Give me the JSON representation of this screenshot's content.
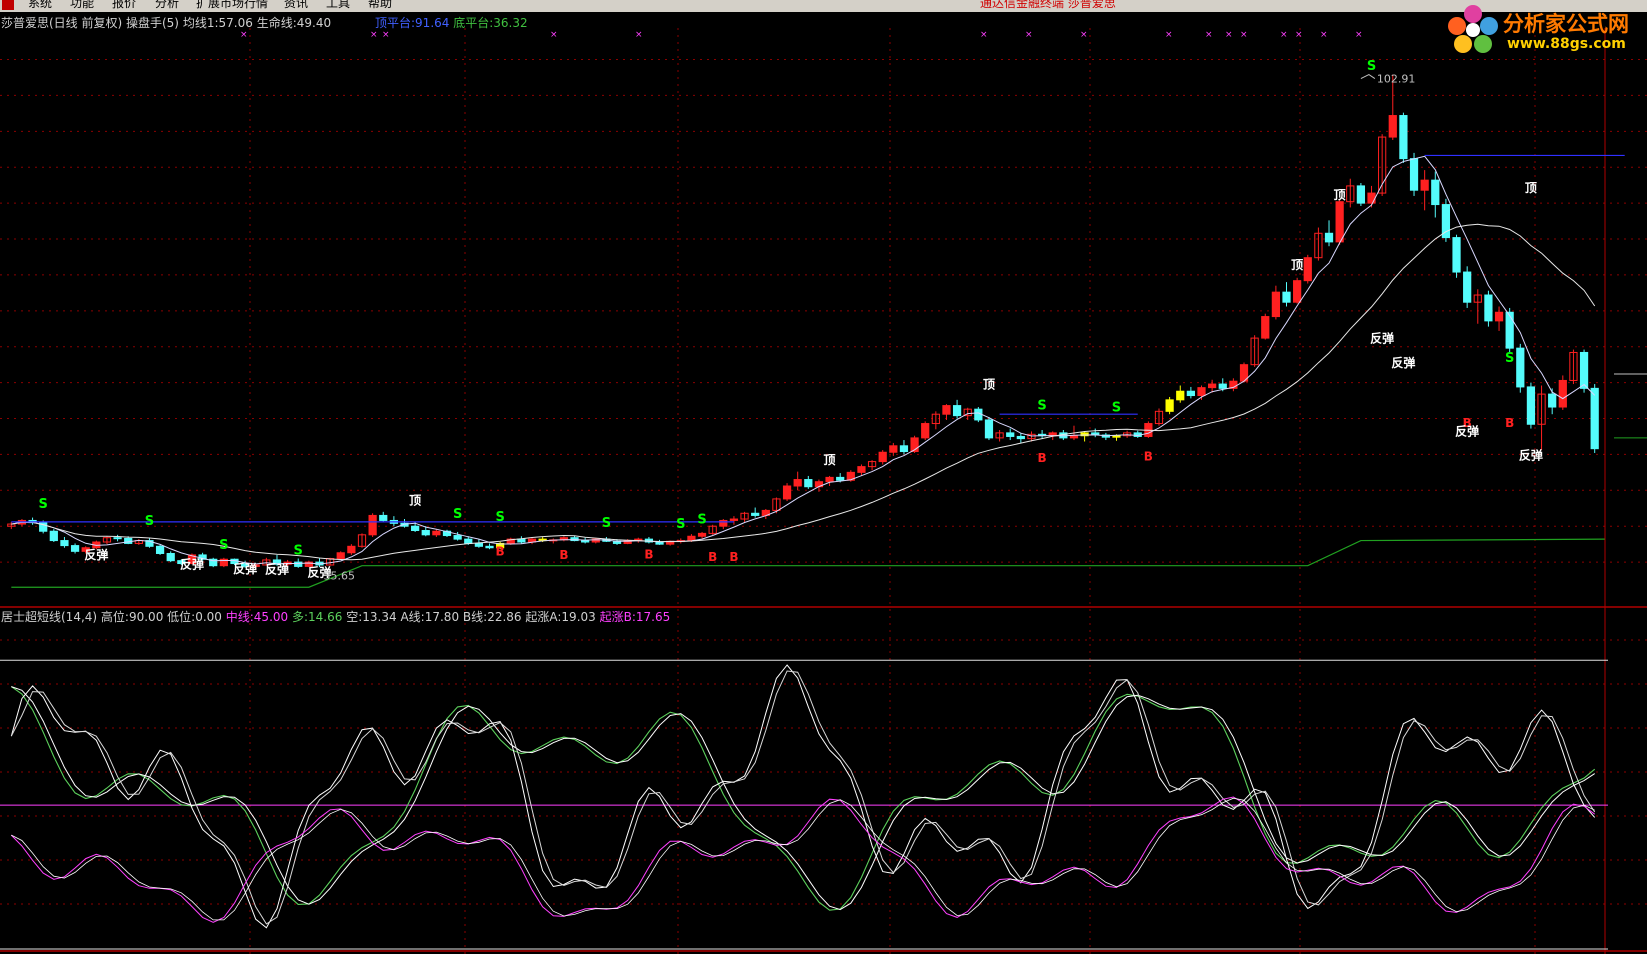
{
  "menu": {
    "items": [
      "系统",
      "功能",
      "报价",
      "分析",
      "扩展市场行情",
      "资讯",
      "工具",
      "帮助"
    ],
    "promo": "通达信金融终端  莎普爱思"
  },
  "brand": {
    "name": "分析家公式网",
    "url": "www.88gs.com"
  },
  "main_header": {
    "title": "莎普爱思(日线 前复权) 操盘手(5)",
    "ma1_label": "均线1:",
    "ma1_value": "57.06",
    "life_label": "生命线:",
    "life_value": "49.40",
    "top_platform_label": "顶平台:",
    "top_platform_value": "91.64",
    "bottom_platform_label": "底平台:",
    "bottom_platform_value": "36.32"
  },
  "indicator_header": {
    "title": "居士超短线(14,4)",
    "high_label": "高位:",
    "high_value": "90.00",
    "low_label": "低位:",
    "low_value": "0.00",
    "mid_label": "中线:",
    "mid_value": "45.00",
    "long_label": "多:",
    "long_value": "14.66",
    "short_label": "空:",
    "short_value": "13.34",
    "a_label": "A线:",
    "a_value": "17.80",
    "b_label": "B线:",
    "b_value": "22.86",
    "risea_label": "起涨A:",
    "risea_value": "19.03",
    "riseb_label": "起涨B:",
    "riseb_value": "17.65"
  },
  "annotations": {
    "peak_price": "102.91",
    "low_price": "35.65",
    "top_label": "顶",
    "rebound_label": "反弹",
    "buy_label": "B",
    "sell_label": "S"
  },
  "colors": {
    "up": "#ff2020",
    "down": "#54fcfc",
    "flat": "#ffff00",
    "ma": "#d8d8ff",
    "life": "#e8e8e8",
    "platform_top": "#3030ff",
    "platform_bottom": "#20a020",
    "buy": "#ff2020",
    "sell": "#00ff00",
    "grid": "#8b0000",
    "magenta": "#ff40ff",
    "green": "#5cd05c"
  },
  "chart_data": {
    "type": "candlestick",
    "price_range": [
      30,
      108
    ],
    "ohlc": [
      [
        40,
        40.6,
        39.6,
        40.3
      ],
      [
        40.3,
        41,
        40,
        40.8
      ],
      [
        40.8,
        41.2,
        40.2,
        40.5
      ],
      [
        40.5,
        40.8,
        39,
        39.3
      ],
      [
        39.3,
        39.6,
        37.8,
        38
      ],
      [
        38,
        38.5,
        37,
        37.3
      ],
      [
        37.3,
        37.6,
        36.2,
        36.5
      ],
      [
        36.5,
        37.2,
        36.2,
        37
      ],
      [
        37,
        38,
        36.8,
        37.8
      ],
      [
        37.8,
        38.6,
        37.5,
        38.4
      ],
      [
        38.4,
        38.8,
        37.9,
        38.3
      ],
      [
        38.3,
        38.6,
        37.5,
        37.6
      ],
      [
        37.6,
        38.2,
        37.4,
        38
      ],
      [
        38,
        38.3,
        37,
        37.2
      ],
      [
        37.2,
        37.4,
        36,
        36.2
      ],
      [
        36.2,
        36.5,
        35,
        35.2
      ],
      [
        35.2,
        35.4,
        34.6,
        34.8
      ],
      [
        34.8,
        36.2,
        34.7,
        36
      ],
      [
        36,
        36.3,
        35.2,
        35.4
      ],
      [
        35.4,
        35.6,
        34.3,
        34.5
      ],
      [
        34.5,
        35.6,
        34.3,
        35.4
      ],
      [
        35.4,
        35.5,
        34.6,
        34.8
      ],
      [
        34.8,
        35.2,
        34.2,
        34.4
      ],
      [
        34.4,
        34.8,
        34,
        34.6
      ],
      [
        34.6,
        35.6,
        34.5,
        35.3
      ],
      [
        35.3,
        36,
        34.5,
        34.7
      ],
      [
        34.7,
        35.3,
        34.3,
        35
      ],
      [
        35,
        35.5,
        34.2,
        34.4
      ],
      [
        34.4,
        35.2,
        34.3,
        35
      ],
      [
        35,
        35.5,
        34.3,
        34.6
      ],
      [
        34.6,
        35.6,
        34.5,
        35.5
      ],
      [
        35.5,
        36.5,
        35.3,
        36.3
      ],
      [
        36.3,
        37.5,
        36,
        37.2
      ],
      [
        37.2,
        39,
        37,
        38.8
      ],
      [
        38.8,
        41.8,
        38.5,
        41.5
      ],
      [
        41.5,
        42,
        40.6,
        40.8
      ],
      [
        40.8,
        41.4,
        40,
        40.4
      ],
      [
        40.4,
        41,
        39.8,
        40
      ],
      [
        40,
        40.6,
        39.2,
        39.4
      ],
      [
        39.4,
        40,
        38.6,
        38.8
      ],
      [
        38.8,
        39.6,
        38.5,
        39.3
      ],
      [
        39.3,
        39.5,
        38.5,
        38.7
      ],
      [
        38.7,
        39.2,
        38,
        38.2
      ],
      [
        38.2,
        38.6,
        37.4,
        37.6
      ],
      [
        37.6,
        38.2,
        37,
        37.2
      ],
      [
        37.2,
        37.6,
        36.8,
        37
      ],
      [
        37,
        37.8,
        36.8,
        37.6
      ],
      [
        37.6,
        38.4,
        37.4,
        38.2
      ],
      [
        38.2,
        38.6,
        37.6,
        37.8
      ],
      [
        37.8,
        38.4,
        37.5,
        38.2
      ],
      [
        38.2,
        38.5,
        37.8,
        38
      ],
      [
        38,
        38.3,
        37.6,
        38.1
      ],
      [
        38.1,
        38.6,
        37.9,
        38.4
      ],
      [
        38.4,
        38.7,
        37.9,
        38
      ],
      [
        38,
        38.4,
        37.6,
        37.8
      ],
      [
        37.8,
        38.3,
        37.6,
        38.2
      ],
      [
        38.2,
        38.5,
        37.8,
        37.9
      ],
      [
        37.9,
        38.2,
        37.4,
        37.6
      ],
      [
        37.6,
        38.2,
        37.5,
        38
      ],
      [
        38,
        38.4,
        37.7,
        38.2
      ],
      [
        38.2,
        38.5,
        37.6,
        37.8
      ],
      [
        37.8,
        38.1,
        37.4,
        37.5
      ],
      [
        37.5,
        38,
        37.3,
        37.9
      ],
      [
        37.9,
        38.3,
        37.6,
        38
      ],
      [
        38,
        38.9,
        37.8,
        38.6
      ],
      [
        38.6,
        39.2,
        38.3,
        39
      ],
      [
        39,
        40.2,
        38.8,
        40
      ],
      [
        40,
        41,
        39.6,
        40.8
      ],
      [
        40.8,
        41.4,
        40.2,
        41
      ],
      [
        41,
        42,
        40.6,
        41.8
      ],
      [
        41.8,
        42.6,
        41.2,
        41.5
      ],
      [
        41.5,
        42.4,
        41,
        42.2
      ],
      [
        42.2,
        44,
        41.8,
        43.8
      ],
      [
        43.8,
        46,
        43.5,
        45.6
      ],
      [
        45.6,
        47.6,
        45,
        46.5
      ],
      [
        46.5,
        47,
        45.2,
        45.5
      ],
      [
        45.5,
        46.5,
        44.8,
        46.2
      ],
      [
        46.2,
        47,
        45.6,
        46.8
      ],
      [
        46.8,
        47.4,
        46.1,
        46.4
      ],
      [
        46.4,
        47.8,
        46.2,
        47.5
      ],
      [
        47.5,
        48.6,
        47,
        48.3
      ],
      [
        48.3,
        49.2,
        47.8,
        49
      ],
      [
        49,
        50.6,
        48.6,
        50.3
      ],
      [
        50.3,
        51.6,
        49.8,
        51.2
      ],
      [
        51.2,
        52,
        50,
        50.4
      ],
      [
        50.4,
        52.6,
        50.2,
        52.3
      ],
      [
        52.3,
        54.6,
        52,
        54.3
      ],
      [
        54.3,
        56,
        53.5,
        55.6
      ],
      [
        55.6,
        57,
        54.8,
        56.8
      ],
      [
        56.8,
        57.6,
        55,
        55.4
      ],
      [
        55.4,
        56.5,
        54.8,
        56.3
      ],
      [
        56.3,
        56.6,
        54.5,
        54.8
      ],
      [
        54.8,
        55.2,
        52,
        52.3
      ],
      [
        52.3,
        53.4,
        51.8,
        53
      ],
      [
        53,
        53.6,
        52,
        52.5
      ],
      [
        52.5,
        53,
        51.6,
        52.2
      ],
      [
        52.2,
        53.2,
        51.8,
        52.8
      ],
      [
        52.8,
        53.4,
        52.2,
        52.6
      ],
      [
        52.6,
        53.2,
        52,
        53
      ],
      [
        53,
        53.4,
        52,
        52.3
      ],
      [
        52.3,
        54,
        52,
        52.6
      ],
      [
        52.6,
        53.2,
        51.8,
        53
      ],
      [
        53,
        53.6,
        52.4,
        52.7
      ],
      [
        52.7,
        53,
        52,
        52.4
      ],
      [
        52.4,
        52.8,
        51.9,
        52.6
      ],
      [
        52.6,
        53.3,
        52.3,
        53
      ],
      [
        53,
        53.3,
        52.3,
        52.5
      ],
      [
        52.5,
        54.6,
        52.3,
        54.3
      ],
      [
        54.3,
        56.4,
        54,
        56
      ],
      [
        56,
        58,
        55.6,
        57.6
      ],
      [
        57.6,
        59.6,
        57.2,
        58.8
      ],
      [
        58.8,
        59.4,
        57.8,
        58.2
      ],
      [
        58.2,
        59.6,
        57.6,
        59.3
      ],
      [
        59.3,
        60.4,
        58.6,
        59.8
      ],
      [
        59.8,
        60.6,
        58.8,
        59.2
      ],
      [
        59.2,
        60.6,
        58.8,
        60.2
      ],
      [
        60.2,
        62.8,
        60,
        62.5
      ],
      [
        62.5,
        66.6,
        62.2,
        66.2
      ],
      [
        66.2,
        69.6,
        66,
        69.2
      ],
      [
        69.2,
        73.5,
        68.8,
        72.6
      ],
      [
        72.6,
        74,
        70.6,
        71.2
      ],
      [
        71.2,
        74.6,
        71,
        74.2
      ],
      [
        74.2,
        77.8,
        73.8,
        77.4
      ],
      [
        77.4,
        81.6,
        77,
        80.8
      ],
      [
        80.8,
        82.6,
        79,
        79.6
      ],
      [
        79.6,
        85.6,
        79.2,
        85.2
      ],
      [
        85.2,
        88.4,
        84.4,
        87.4
      ],
      [
        87.4,
        87.8,
        84.6,
        85
      ],
      [
        85,
        87.4,
        84.4,
        86.4
      ],
      [
        86.4,
        94.6,
        86,
        94.2
      ],
      [
        94.2,
        102.91,
        93.8,
        97.2
      ],
      [
        97.2,
        97.6,
        90.6,
        91.2
      ],
      [
        91.2,
        92,
        86,
        86.8
      ],
      [
        86.8,
        89.6,
        84,
        88.2
      ],
      [
        88.2,
        89.4,
        83,
        84.8
      ],
      [
        84.8,
        85.6,
        79.6,
        80.2
      ],
      [
        80.2,
        80.6,
        74.6,
        75.4
      ],
      [
        75.4,
        76.2,
        70.4,
        71.2
      ],
      [
        71.2,
        73,
        68.2,
        72.2
      ],
      [
        72.2,
        72.8,
        67.8,
        68.6
      ],
      [
        68.6,
        70.6,
        67.2,
        69.8
      ],
      [
        69.8,
        70.4,
        64.2,
        64.8
      ],
      [
        64.8,
        65.4,
        58.6,
        59.4
      ],
      [
        59.4,
        60,
        53.6,
        54.2
      ],
      [
        54.2,
        59.6,
        50.6,
        58.4
      ],
      [
        58.4,
        59.2,
        55.6,
        56.6
      ],
      [
        56.6,
        61,
        56.2,
        60.3
      ],
      [
        60.3,
        64.6,
        59.8,
        64.2
      ],
      [
        64.2,
        64.6,
        58.6,
        59.2
      ],
      [
        59.2,
        59.8,
        50.2,
        50.8
      ]
    ]
  }
}
